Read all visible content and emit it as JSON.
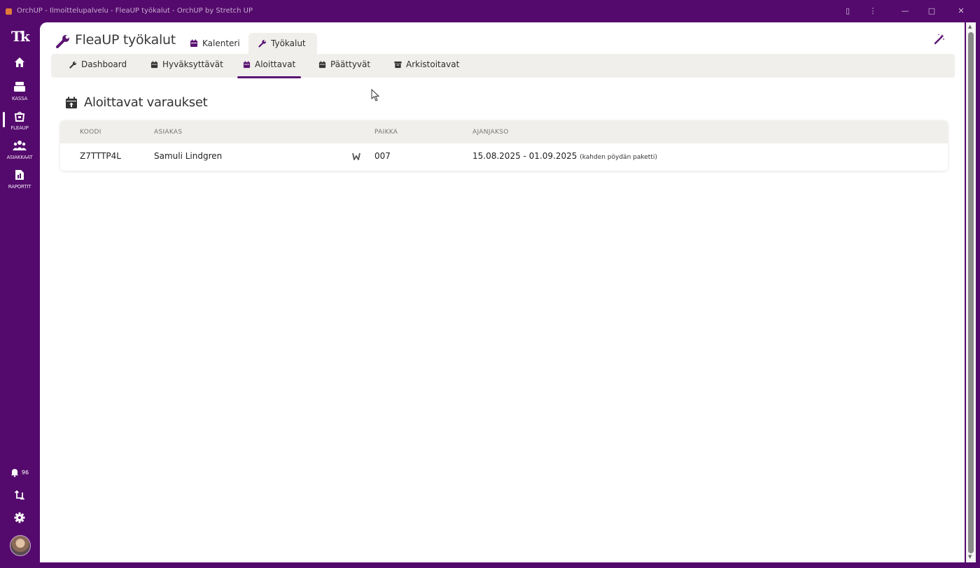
{
  "window": {
    "title": "OrchUP - Ilmoittelupalvelu - FleaUP työkalut - OrchUP by Stretch UP",
    "controls": [
      "▯",
      "⋮",
      "—",
      "□",
      "✕"
    ]
  },
  "rail": {
    "logo": "Tk",
    "items": [
      {
        "icon": "home-icon",
        "label": ""
      },
      {
        "icon": "cash-register-icon",
        "label": "KASSA"
      },
      {
        "icon": "fleaup-icon",
        "label": "FLEAUP"
      },
      {
        "icon": "customers-icon",
        "label": "ASIAKKAAT"
      },
      {
        "icon": "reports-icon",
        "label": "RAPORTIT"
      }
    ],
    "notifications_label": "96"
  },
  "header": {
    "title": "FleaUP työkalut",
    "tabs": [
      {
        "label": "Kalenteri",
        "icon": "calendar-icon",
        "active": false
      },
      {
        "label": "Työkalut",
        "icon": "wrench-icon",
        "active": true
      }
    ]
  },
  "subtabs": [
    {
      "label": "Dashboard",
      "icon": "wrench-icon",
      "active": false
    },
    {
      "label": "Hyväksyttävät",
      "icon": "calendar-check-icon",
      "active": false
    },
    {
      "label": "Aloittavat",
      "icon": "calendar-arrow-icon",
      "active": true
    },
    {
      "label": "Päättyvät",
      "icon": "calendar-end-icon",
      "active": false
    },
    {
      "label": "Arkistoitavat",
      "icon": "archive-icon",
      "active": false
    }
  ],
  "section": {
    "title": "Aloittavat varaukset",
    "columns": [
      "KOODI",
      "ASIAKAS",
      "PAIKKA",
      "AJANJAKSO"
    ],
    "rows": [
      {
        "code": "Z7TTTP4L",
        "customer": "Samuli Lindgren",
        "place": "007",
        "period": "15.08.2025 - 01.09.2025",
        "period_note": "(kahden pöydän paketti)"
      }
    ]
  },
  "colors": {
    "brand": "#540a6c",
    "accent": "#5a1472",
    "surface": "#f1efec"
  }
}
